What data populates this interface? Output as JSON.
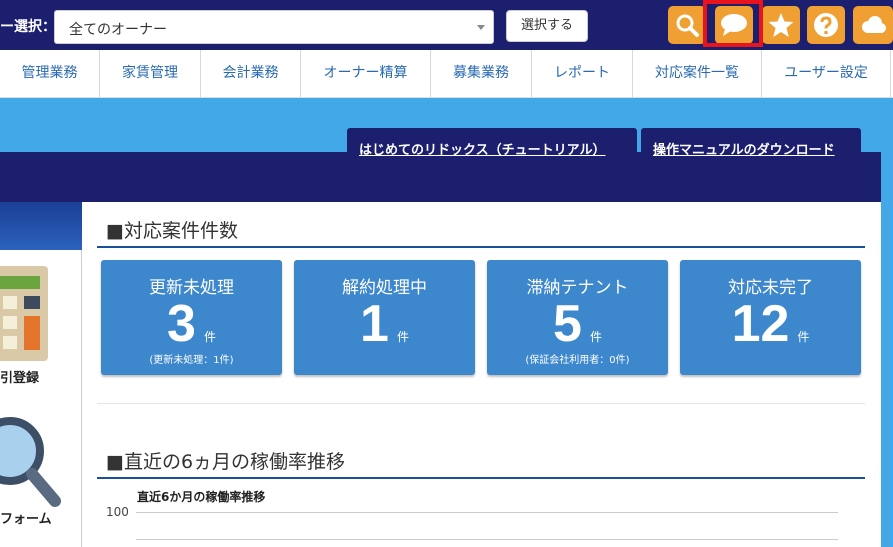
{
  "header": {
    "owner_label": "ー選択：",
    "owner_select_value": "全てのオーナー",
    "select_button": "選択する",
    "icons": [
      "search-icon",
      "chat-icon",
      "star-icon",
      "help-icon",
      "cloud-icon"
    ],
    "accent_color": "#f0a033",
    "highlight_color": "#e8131d"
  },
  "nav": {
    "items": [
      "管理業務",
      "家賃管理",
      "会計業務",
      "オーナー精算",
      "募集業務",
      "レポート",
      "対応案件一覧",
      "ユーザー設定"
    ]
  },
  "links": {
    "tutorial": "はじめてのリドックス（チュートリアル）",
    "manual": "操作マニュアルのダウンロード"
  },
  "sidebar": {
    "items": [
      {
        "label": "引登録",
        "icon": "calculator-icon"
      },
      {
        "label": "フォーム",
        "icon": "magnifier-icon"
      }
    ]
  },
  "cases": {
    "title": "■対応案件件数",
    "cards": [
      {
        "title": "更新未処理",
        "count": "3",
        "unit": "件",
        "sub": "(更新未処理：1件)"
      },
      {
        "title": "解約処理中",
        "count": "1",
        "unit": "件",
        "sub": ""
      },
      {
        "title": "滞納テナント",
        "count": "5",
        "unit": "件",
        "sub": "(保証会社利用者：0件)"
      },
      {
        "title": "対応未完了",
        "count": "12",
        "unit": "件",
        "sub": ""
      }
    ]
  },
  "occupancy": {
    "title": "■直近の6ヵ月の稼働率推移",
    "chart_title": "直近6か月の稼働率推移",
    "y_tick": "100"
  }
}
